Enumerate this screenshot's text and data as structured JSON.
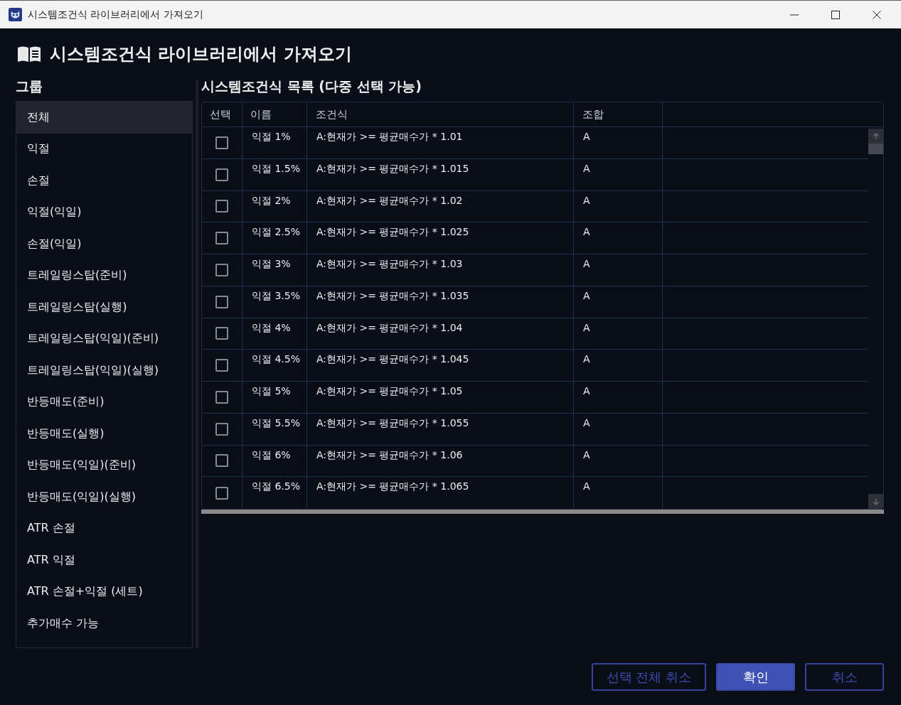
{
  "window": {
    "title": "시스템조건식 라이브러리에서 가져오기"
  },
  "header": {
    "title": "시스템조건식 라이브러리에서 가져오기"
  },
  "groups": {
    "label": "그룹",
    "items": [
      {
        "label": "전체",
        "selected": true
      },
      {
        "label": "익절",
        "selected": false
      },
      {
        "label": "손절",
        "selected": false
      },
      {
        "label": "익절(익일)",
        "selected": false
      },
      {
        "label": "손절(익일)",
        "selected": false
      },
      {
        "label": "트레일링스탑(준비)",
        "selected": false
      },
      {
        "label": "트레일링스탑(실행)",
        "selected": false
      },
      {
        "label": "트레일링스탑(익일)(준비)",
        "selected": false
      },
      {
        "label": "트레일링스탑(익일)(실행)",
        "selected": false
      },
      {
        "label": "반등매도(준비)",
        "selected": false
      },
      {
        "label": "반등매도(실행)",
        "selected": false
      },
      {
        "label": "반등매도(익일)(준비)",
        "selected": false
      },
      {
        "label": "반등매도(익일)(실행)",
        "selected": false
      },
      {
        "label": "ATR 손절",
        "selected": false
      },
      {
        "label": "ATR 익절",
        "selected": false
      },
      {
        "label": "ATR 손절+익절 (세트)",
        "selected": false
      },
      {
        "label": "추가매수 가능",
        "selected": false
      }
    ]
  },
  "conditions": {
    "title": "시스템조건식 목록 (다중 선택 가능)",
    "columns": [
      "선택",
      "이름",
      "조건식",
      "조합"
    ],
    "rows": [
      {
        "checked": false,
        "name": "익절 1%",
        "formula": "A:현재가 >= 평균매수가 * 1.01",
        "combination": "A"
      },
      {
        "checked": false,
        "name": "익절 1.5%",
        "formula": "A:현재가 >= 평균매수가 * 1.015",
        "combination": "A"
      },
      {
        "checked": false,
        "name": "익절 2%",
        "formula": "A:현재가 >= 평균매수가 * 1.02",
        "combination": "A"
      },
      {
        "checked": false,
        "name": "익절 2.5%",
        "formula": "A:현재가 >= 평균매수가 * 1.025",
        "combination": "A"
      },
      {
        "checked": false,
        "name": "익절 3%",
        "formula": "A:현재가 >= 평균매수가 * 1.03",
        "combination": "A"
      },
      {
        "checked": false,
        "name": "익절 3.5%",
        "formula": "A:현재가 >= 평균매수가 * 1.035",
        "combination": "A"
      },
      {
        "checked": false,
        "name": "익절 4%",
        "formula": "A:현재가 >= 평균매수가 * 1.04",
        "combination": "A"
      },
      {
        "checked": false,
        "name": "익절 4.5%",
        "formula": "A:현재가 >= 평균매수가 * 1.045",
        "combination": "A"
      },
      {
        "checked": false,
        "name": "익절 5%",
        "formula": "A:현재가 >= 평균매수가 * 1.05",
        "combination": "A"
      },
      {
        "checked": false,
        "name": "익절 5.5%",
        "formula": "A:현재가 >= 평균매수가 * 1.055",
        "combination": "A"
      },
      {
        "checked": false,
        "name": "익절 6%",
        "formula": "A:현재가 >= 평균매수가 * 1.06",
        "combination": "A"
      },
      {
        "checked": false,
        "name": "익절 6.5%",
        "formula": "A:현재가 >= 평균매수가 * 1.065",
        "combination": "A"
      }
    ]
  },
  "buttons": [
    {
      "label": "선택 전체 취소",
      "kind": "outline"
    },
    {
      "label": "확인",
      "kind": "primary"
    },
    {
      "label": "취소",
      "kind": "outline"
    }
  ]
}
